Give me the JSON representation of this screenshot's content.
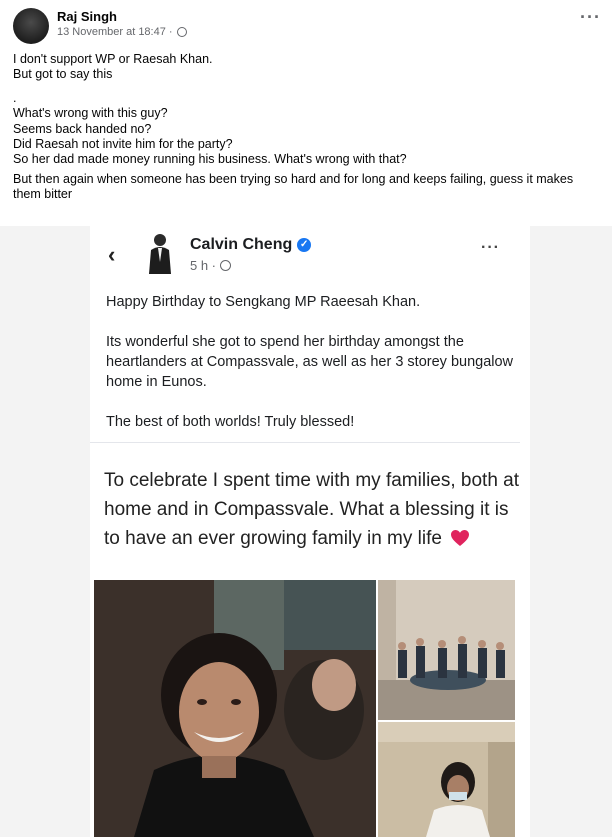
{
  "post": {
    "author": "Raj Singh",
    "timestamp": "13 November at 18:47 ·",
    "lines": [
      "I don't support WP or Raesah Khan.",
      "But got to say this",
      ".",
      "What's wrong with this guy?",
      "Seems back handed no?",
      "Did Raesah not invite him for the party?",
      "So her dad made money running his business. What's wrong with that?"
    ],
    "closing": "But then again when someone has been trying so hard and for long and keeps failing, guess it makes them bitter"
  },
  "shared_post": {
    "author": "Calvin Cheng",
    "time": "5 h ·",
    "paragraphs": [
      "Happy Birthday to Sengkang MP Raeesah Khan.",
      "Its wonderful she got to spend her birthday amongst the heartlanders at Compassvale, as well as her 3 storey bungalow home in Eunos.",
      "The best of both worlds! Truly blessed!"
    ],
    "quoted_text": "To celebrate I spent time with my families, both at home and in Compassvale. What a blessing it is to have an ever growing family in my life"
  },
  "icons": {
    "privacy": "globe-icon",
    "more": "more-options-icon",
    "verified": "verified-badge-icon",
    "back": "chevron-left-icon",
    "heart": "red-heart-icon"
  },
  "colors": {
    "meta_text": "#65676b",
    "verified": "#1877f2",
    "heart": "#e0245e"
  }
}
